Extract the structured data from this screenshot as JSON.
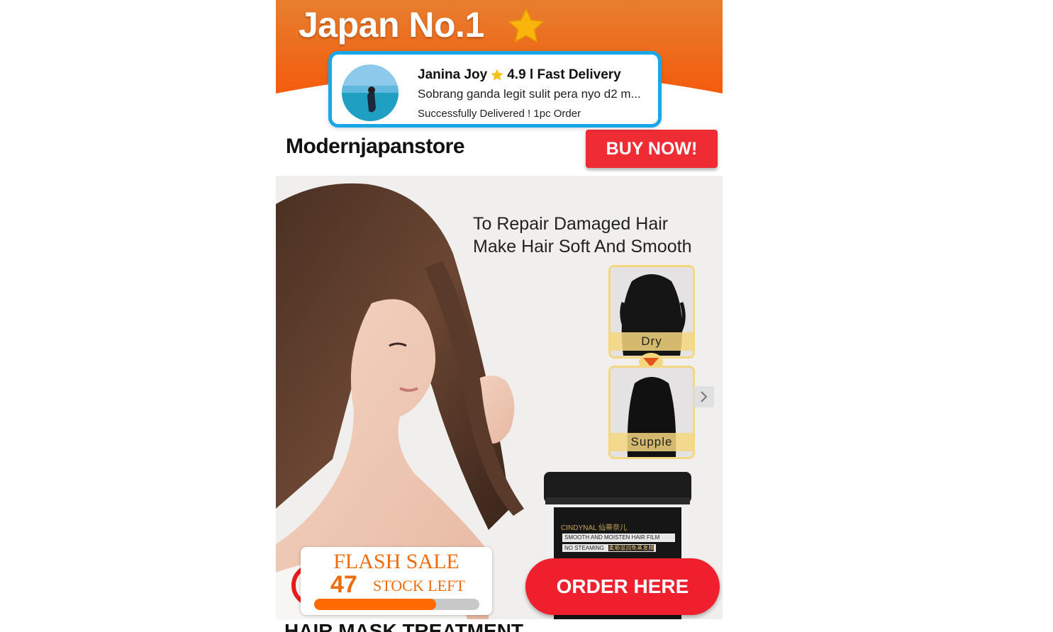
{
  "banner": {
    "title": "Japan No.1",
    "rating_stars": 5,
    "colors": {
      "top": "#e97b2a",
      "bottom": "#f25c0f",
      "star": "#f7b500"
    }
  },
  "notification": {
    "name": "Janina Joy",
    "rating_text": "4.9 l Fast Delivery",
    "message": "Sobrang ganda legit sulit pera nyo d2 m...",
    "status": "Successfully Delivered ! 1pc Order",
    "border_color": "#1aa7e8"
  },
  "store": {
    "name": "Modernjapanstore",
    "buy_label": "BUY NOW!"
  },
  "product": {
    "headline_line1": "To Repair Damaged Hair",
    "headline_line2": "Make Hair Soft And Smooth",
    "swatch_dry": "Dry",
    "swatch_supple": "Supple",
    "jar_brand": "CINDYNAL 仙蒂奈儿",
    "jar_line1": "SMOOTH AND MOISTEN HAIR FILM",
    "jar_line2": "NO STEAMING",
    "jar_line2_cn": "柔顺滋润免蒸发膜"
  },
  "flash_sale": {
    "title": "FLASH SALE",
    "count": "47",
    "stock_label": "STOCK LEFT",
    "progress_fraction": 0.74
  },
  "order": {
    "label": "ORDER HERE"
  },
  "footer": {
    "title": "HAIR MASK TREATMENT"
  }
}
